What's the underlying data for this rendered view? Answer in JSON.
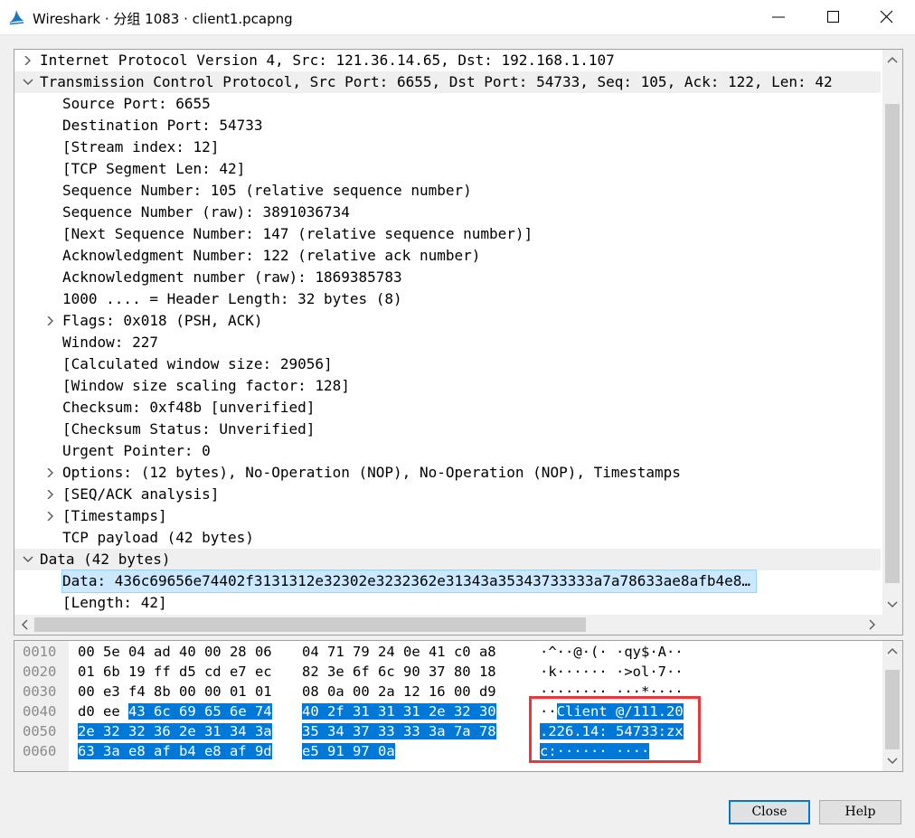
{
  "window": {
    "title": "Wireshark · 分组 1083 · client1.pcapng",
    "icon": "wireshark-fin-icon",
    "controls": [
      "minimize-icon",
      "maximize-icon",
      "close-icon"
    ]
  },
  "tree": [
    {
      "text": "Internet Protocol Version 4, Src: 121.36.14.65, Dst: 192.168.1.107",
      "level": 0,
      "expander": "collapsed",
      "alt": false
    },
    {
      "text": "Transmission Control Protocol, Src Port: 6655, Dst Port: 54733, Seq: 105, Ack: 122, Len: 42",
      "level": 0,
      "expander": "expanded",
      "alt": true
    },
    {
      "text": "Source Port: 6655",
      "level": 1,
      "expander": "none",
      "alt": false
    },
    {
      "text": "Destination Port: 54733",
      "level": 1,
      "expander": "none",
      "alt": false
    },
    {
      "text": "[Stream index: 12]",
      "level": 1,
      "expander": "none",
      "alt": false
    },
    {
      "text": "[TCP Segment Len: 42]",
      "level": 1,
      "expander": "none",
      "alt": false
    },
    {
      "text": "Sequence Number: 105    (relative sequence number)",
      "level": 1,
      "expander": "none",
      "alt": false
    },
    {
      "text": "Sequence Number (raw): 3891036734",
      "level": 1,
      "expander": "none",
      "alt": false
    },
    {
      "text": "[Next Sequence Number: 147    (relative sequence number)]",
      "level": 1,
      "expander": "none",
      "alt": false
    },
    {
      "text": "Acknowledgment Number: 122    (relative ack number)",
      "level": 1,
      "expander": "none",
      "alt": false
    },
    {
      "text": "Acknowledgment number (raw): 1869385783",
      "level": 1,
      "expander": "none",
      "alt": false
    },
    {
      "text": "1000 .... = Header Length: 32 bytes (8)",
      "level": 1,
      "expander": "none",
      "alt": false
    },
    {
      "text": "Flags: 0x018 (PSH, ACK)",
      "level": 1,
      "expander": "collapsed",
      "alt": false
    },
    {
      "text": "Window: 227",
      "level": 1,
      "expander": "none",
      "alt": false
    },
    {
      "text": "[Calculated window size: 29056]",
      "level": 1,
      "expander": "none",
      "alt": false
    },
    {
      "text": "[Window size scaling factor: 128]",
      "level": 1,
      "expander": "none",
      "alt": false
    },
    {
      "text": "Checksum: 0xf48b [unverified]",
      "level": 1,
      "expander": "none",
      "alt": false
    },
    {
      "text": "[Checksum Status: Unverified]",
      "level": 1,
      "expander": "none",
      "alt": false
    },
    {
      "text": "Urgent Pointer: 0",
      "level": 1,
      "expander": "none",
      "alt": false
    },
    {
      "text": "Options: (12 bytes), No-Operation (NOP), No-Operation (NOP), Timestamps",
      "level": 1,
      "expander": "collapsed",
      "alt": false
    },
    {
      "text": "[SEQ/ACK analysis]",
      "level": 1,
      "expander": "collapsed",
      "alt": false
    },
    {
      "text": "[Timestamps]",
      "level": 1,
      "expander": "collapsed",
      "alt": false
    },
    {
      "text": "TCP payload (42 bytes)",
      "level": 1,
      "expander": "none",
      "alt": false
    },
    {
      "text": "Data (42 bytes)",
      "level": 0,
      "expander": "expanded",
      "alt": true
    },
    {
      "text": "Data: 436c69656e74402f3131312e32302e3232362e31343a35343733333a7a78633ae8afb4e8…",
      "level": 1,
      "expander": "none",
      "alt": false,
      "selected": true
    },
    {
      "text": "[Length: 42]",
      "level": 1,
      "expander": "none",
      "alt": false
    }
  ],
  "hex_rows": [
    {
      "offset": "0010",
      "hex1": "00 5e 04 ad 40 00 28 06",
      "hex2": "04 71 79 24 0e 41 c0 a8",
      "ascii": "·^··@·(· ·qy$·A··",
      "sel_hex_start": -1,
      "sel_ascii_start": -1
    },
    {
      "offset": "0020",
      "hex1": "01 6b 19 ff d5 cd e7 ec",
      "hex2": "82 3e 6f 6c 90 37 80 18",
      "ascii": "·k······ ·>ol·7··",
      "sel_hex_start": -1,
      "sel_ascii_start": -1
    },
    {
      "offset": "0030",
      "hex1": "00 e3 f4 8b 00 00 01 01",
      "hex2": "08 0a 00 2a 12 16 00 d9",
      "ascii": "········ ···*····",
      "sel_hex_start": -1,
      "sel_ascii_start": -1
    },
    {
      "offset": "0040",
      "hex1": "d0 ee 43 6c 69 65 6e 74",
      "hex2": "40 2f 31 31 31 2e 32 30",
      "ascii": "··Client @/111.20",
      "sel_hex_start": 2,
      "sel_ascii_start": 2
    },
    {
      "offset": "0050",
      "hex1": "2e 32 32 36 2e 31 34 3a",
      "hex2": "35 34 37 33 33 3a 7a 78",
      "ascii": ".226.14: 54733:zx",
      "sel_hex_start": 0,
      "sel_ascii_start": 0
    },
    {
      "offset": "0060",
      "hex1": "63 3a e8 af b4 e8 af 9d",
      "hex2": "e5 91 97 0a",
      "ascii": "c:······ ····",
      "sel_hex_start": 0,
      "sel_ascii_start": 0
    }
  ],
  "buttons": {
    "close_label": "Close",
    "help_label": "Help"
  },
  "colors": {
    "selection": "#0078d7",
    "tree_selected": "#cce8ff",
    "highlight_box": "#e8383d"
  }
}
